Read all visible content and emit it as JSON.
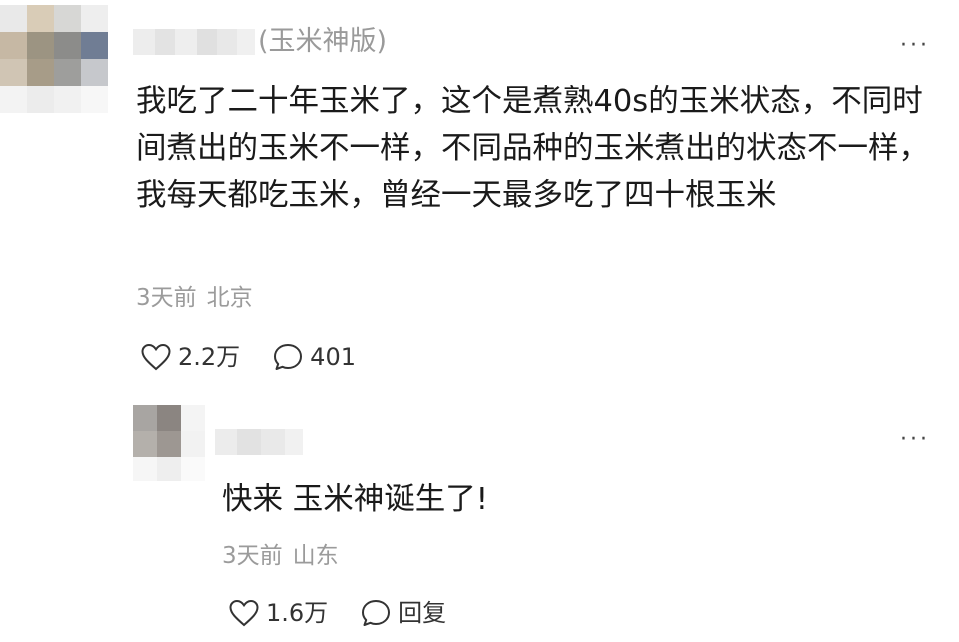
{
  "comments": [
    {
      "tag": "(玉米神版)",
      "text": "我吃了二十年玉米了，这个是煮熟40s的玉米状态，不同时间煮出的玉米不一样，不同品种的玉米煮出的状态不一样，我每天都吃玉米，曾经一天最多吃了四十根玉米",
      "time": "3天前",
      "location": "北京",
      "likes": "2.2万",
      "comments": "401",
      "icons": {
        "like": "heart-icon",
        "comment": "speech-bubble-icon",
        "more": "more-dots-icon"
      }
    }
  ],
  "reply": {
    "text": "快来 玉米神诞生了!",
    "time": "3天前",
    "location": "山东",
    "likes": "1.6万",
    "reply_label": "回复",
    "icons": {
      "like": "heart-icon",
      "comment": "speech-bubble-icon",
      "more": "more-dots-icon"
    }
  },
  "more_glyph": "···",
  "colors": {
    "text": "#1a1a1a",
    "muted": "#9b9b9b",
    "action": "#333333"
  }
}
